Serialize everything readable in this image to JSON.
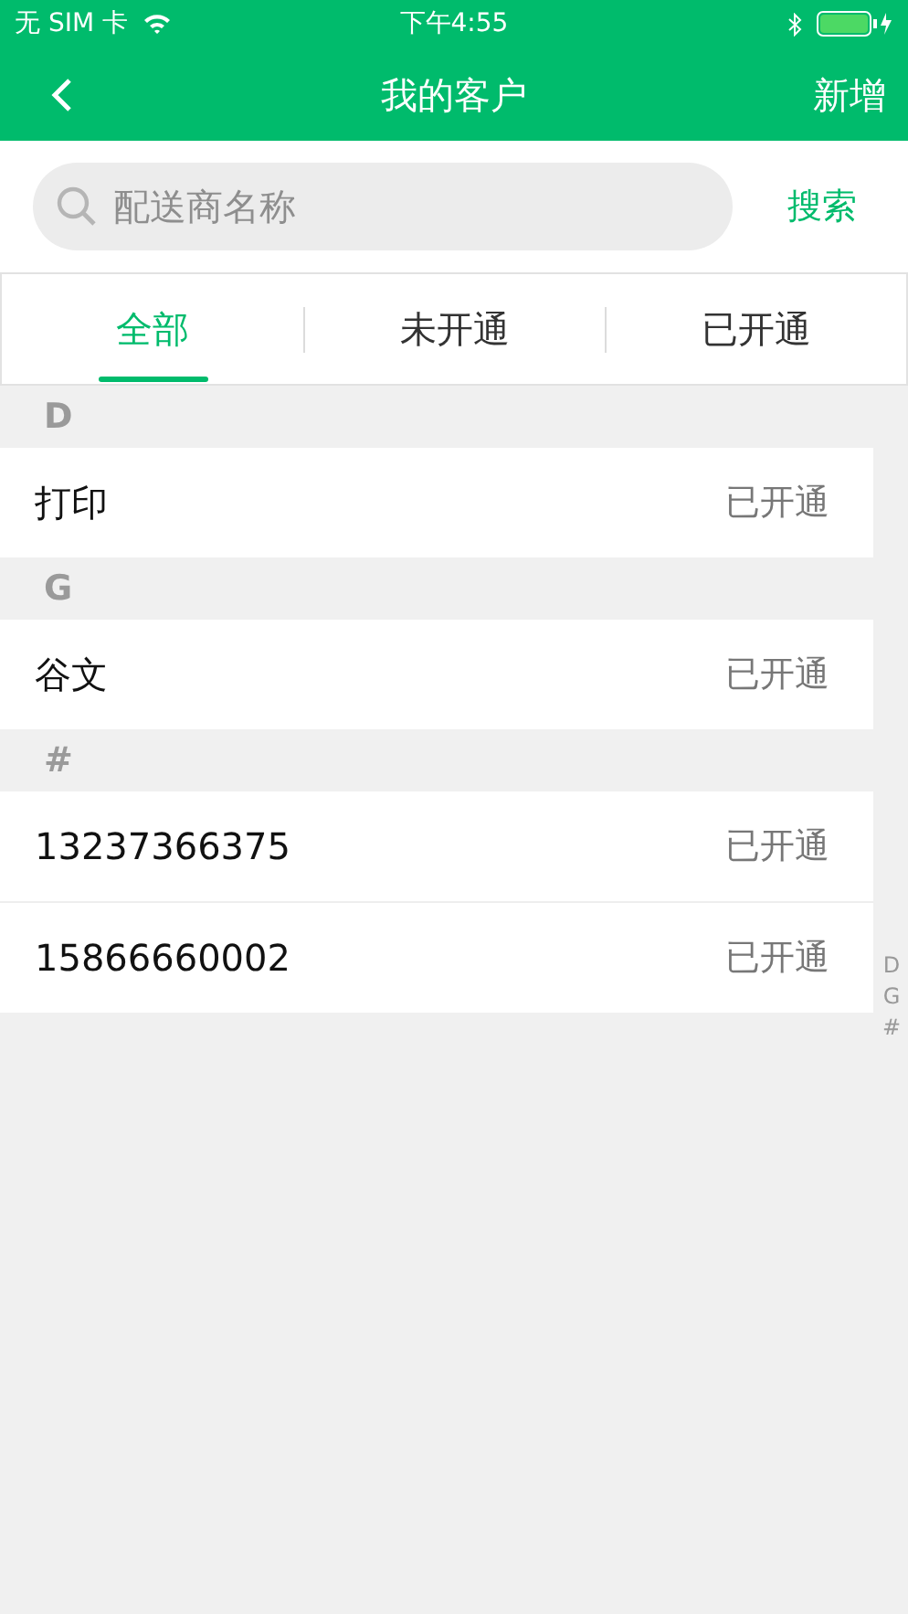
{
  "status_bar": {
    "carrier": "无 SIM 卡",
    "time": "下午4:55"
  },
  "nav": {
    "title": "我的客户",
    "action": "新增"
  },
  "search": {
    "placeholder": "配送商名称",
    "button": "搜索"
  },
  "tabs": [
    {
      "label": "全部",
      "selected": true
    },
    {
      "label": "未开通",
      "selected": false
    },
    {
      "label": "已开通",
      "selected": false
    }
  ],
  "sections": [
    {
      "letter": "D",
      "rows": [
        {
          "name": "打印",
          "status": "已开通"
        }
      ]
    },
    {
      "letter": "G",
      "rows": [
        {
          "name": "谷文",
          "status": "已开通"
        }
      ]
    },
    {
      "letter": "#",
      "rows": [
        {
          "name": "13237366375",
          "status": "已开通"
        },
        {
          "name": "15866660002",
          "status": "已开通"
        }
      ]
    }
  ],
  "index": [
    "D",
    "G",
    "#"
  ]
}
